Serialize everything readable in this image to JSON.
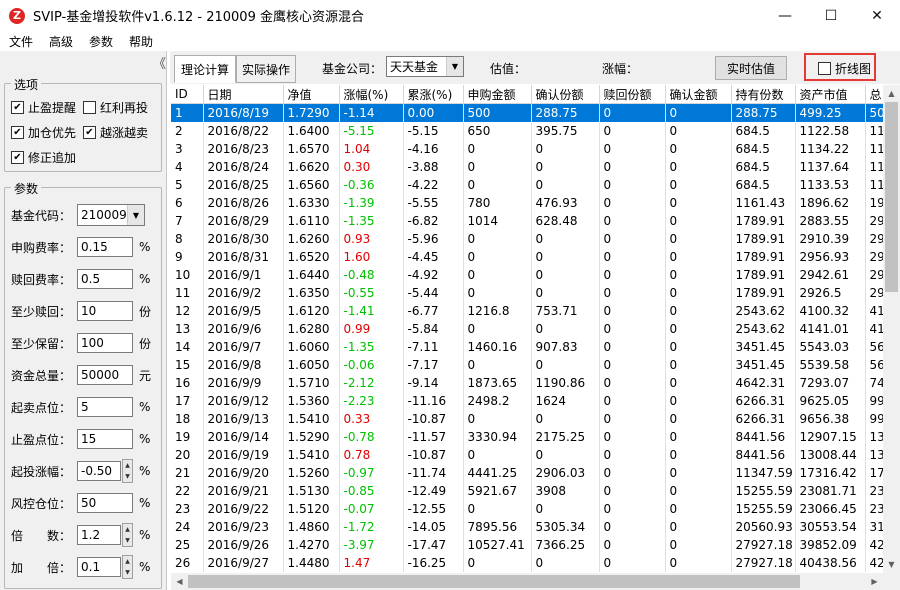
{
  "window": {
    "title": "SVIP-基金增投软件v1.6.12 - 210009 金鹰核心资源混合",
    "logo_letter": "Z",
    "minimize": "—",
    "maximize": "☐",
    "close": "✕"
  },
  "menu": [
    "文件",
    "高级",
    "参数",
    "帮助"
  ],
  "left": {
    "collapse": "《",
    "options_title": "选项",
    "options": [
      {
        "label": "止盈提醒",
        "checked": true
      },
      {
        "label": "红利再投",
        "checked": false
      },
      {
        "label": "加仓优先",
        "checked": true
      },
      {
        "label": "越涨越卖",
        "checked": true
      },
      {
        "label": "修正追加",
        "checked": true
      }
    ],
    "params_title": "参数",
    "fund_code_label": "基金代码：",
    "fund_code": "210009",
    "params": [
      {
        "label": "申购费率：",
        "value": "0.15",
        "unit": "%"
      },
      {
        "label": "赎回费率：",
        "value": "0.5",
        "unit": "%"
      },
      {
        "label": "至少赎回：",
        "value": "10",
        "unit": "份"
      },
      {
        "label": "至少保留：",
        "value": "100",
        "unit": "份"
      },
      {
        "label": "资金总量：",
        "value": "50000",
        "unit": "元"
      },
      {
        "label": "起卖点位：",
        "value": "5",
        "unit": "%"
      },
      {
        "label": "止盈点位：",
        "value": "15",
        "unit": "%"
      },
      {
        "label": "起投涨幅：",
        "value": "-0.50",
        "unit": "%"
      },
      {
        "label": "风控仓位：",
        "value": "50",
        "unit": "%"
      },
      {
        "label": "倍　　数：",
        "value": "1.2",
        "unit": "%"
      },
      {
        "label": "加　　倍：",
        "value": "0.1",
        "unit": "%"
      }
    ]
  },
  "toolbar": {
    "tab_theory": "理论计算",
    "tab_actual": "实际操作",
    "company_label": "基金公司：",
    "company_value": "天天基金",
    "estimate_label": "估值：",
    "change_label": "涨幅：",
    "realtime_button": "实时估值",
    "line_chart_label": "折线图",
    "line_chart_checked": false
  },
  "table": {
    "columns": [
      "ID",
      "日期",
      "净值",
      "涨幅(%)",
      "累涨(%)",
      "申购金额",
      "确认份额",
      "赎回份额",
      "确认金额",
      "持有份数",
      "资产市值",
      "总"
    ],
    "rows": [
      [
        "1",
        "2016/8/19",
        "1.7290",
        "-1.14",
        "0.00",
        "500",
        "288.75",
        "0",
        "0",
        "288.75",
        "499.25",
        "50"
      ],
      [
        "2",
        "2016/8/22",
        "1.6400",
        "-5.15",
        "-5.15",
        "650",
        "395.75",
        "0",
        "0",
        "684.5",
        "1122.58",
        "11"
      ],
      [
        "3",
        "2016/8/23",
        "1.6570",
        "1.04",
        "-4.16",
        "0",
        "0",
        "0",
        "0",
        "684.5",
        "1134.22",
        "11"
      ],
      [
        "4",
        "2016/8/24",
        "1.6620",
        "0.30",
        "-3.88",
        "0",
        "0",
        "0",
        "0",
        "684.5",
        "1137.64",
        "11"
      ],
      [
        "5",
        "2016/8/25",
        "1.6560",
        "-0.36",
        "-4.22",
        "0",
        "0",
        "0",
        "0",
        "684.5",
        "1133.53",
        "11"
      ],
      [
        "6",
        "2016/8/26",
        "1.6330",
        "-1.39",
        "-5.55",
        "780",
        "476.93",
        "0",
        "0",
        "1161.43",
        "1896.62",
        "19"
      ],
      [
        "7",
        "2016/8/29",
        "1.6110",
        "-1.35",
        "-6.82",
        "1014",
        "628.48",
        "0",
        "0",
        "1789.91",
        "2883.55",
        "29"
      ],
      [
        "8",
        "2016/8/30",
        "1.6260",
        "0.93",
        "-5.96",
        "0",
        "0",
        "0",
        "0",
        "1789.91",
        "2910.39",
        "29"
      ],
      [
        "9",
        "2016/8/31",
        "1.6520",
        "1.60",
        "-4.45",
        "0",
        "0",
        "0",
        "0",
        "1789.91",
        "2956.93",
        "29"
      ],
      [
        "10",
        "2016/9/1",
        "1.6440",
        "-0.48",
        "-4.92",
        "0",
        "0",
        "0",
        "0",
        "1789.91",
        "2942.61",
        "29"
      ],
      [
        "11",
        "2016/9/2",
        "1.6350",
        "-0.55",
        "-5.44",
        "0",
        "0",
        "0",
        "0",
        "1789.91",
        "2926.5",
        "29"
      ],
      [
        "12",
        "2016/9/5",
        "1.6120",
        "-1.41",
        "-6.77",
        "1216.8",
        "753.71",
        "0",
        "0",
        "2543.62",
        "4100.32",
        "41"
      ],
      [
        "13",
        "2016/9/6",
        "1.6280",
        "0.99",
        "-5.84",
        "0",
        "0",
        "0",
        "0",
        "2543.62",
        "4141.01",
        "41"
      ],
      [
        "14",
        "2016/9/7",
        "1.6060",
        "-1.35",
        "-7.11",
        "1460.16",
        "907.83",
        "0",
        "0",
        "3451.45",
        "5543.03",
        "56"
      ],
      [
        "15",
        "2016/9/8",
        "1.6050",
        "-0.06",
        "-7.17",
        "0",
        "0",
        "0",
        "0",
        "3451.45",
        "5539.58",
        "56"
      ],
      [
        "16",
        "2016/9/9",
        "1.5710",
        "-2.12",
        "-9.14",
        "1873.65",
        "1190.86",
        "0",
        "0",
        "4642.31",
        "7293.07",
        "74"
      ],
      [
        "17",
        "2016/9/12",
        "1.5360",
        "-2.23",
        "-11.16",
        "2498.2",
        "1624",
        "0",
        "0",
        "6266.31",
        "9625.05",
        "99"
      ],
      [
        "18",
        "2016/9/13",
        "1.5410",
        "0.33",
        "-10.87",
        "0",
        "0",
        "0",
        "0",
        "6266.31",
        "9656.38",
        "99"
      ],
      [
        "19",
        "2016/9/14",
        "1.5290",
        "-0.78",
        "-11.57",
        "3330.94",
        "2175.25",
        "0",
        "0",
        "8441.56",
        "12907.15",
        "13"
      ],
      [
        "20",
        "2016/9/19",
        "1.5410",
        "0.78",
        "-10.87",
        "0",
        "0",
        "0",
        "0",
        "8441.56",
        "13008.44",
        "13"
      ],
      [
        "21",
        "2016/9/20",
        "1.5260",
        "-0.97",
        "-11.74",
        "4441.25",
        "2906.03",
        "0",
        "0",
        "11347.59",
        "17316.42",
        "17"
      ],
      [
        "22",
        "2016/9/21",
        "1.5130",
        "-0.85",
        "-12.49",
        "5921.67",
        "3908",
        "0",
        "0",
        "15255.59",
        "23081.71",
        "23"
      ],
      [
        "23",
        "2016/9/22",
        "1.5120",
        "-0.07",
        "-12.55",
        "0",
        "0",
        "0",
        "0",
        "15255.59",
        "23066.45",
        "23"
      ],
      [
        "24",
        "2016/9/23",
        "1.4860",
        "-1.72",
        "-14.05",
        "7895.56",
        "5305.34",
        "0",
        "0",
        "20560.93",
        "30553.54",
        "31"
      ],
      [
        "25",
        "2016/9/26",
        "1.4270",
        "-3.97",
        "-17.47",
        "10527.41",
        "7366.25",
        "0",
        "0",
        "27927.18",
        "39852.09",
        "42"
      ],
      [
        "26",
        "2016/9/27",
        "1.4480",
        "1.47",
        "-16.25",
        "0",
        "0",
        "0",
        "0",
        "27927.18",
        "40438.56",
        "42"
      ]
    ]
  },
  "colors": {
    "up": "#e00000",
    "down": "#00c000",
    "selected_row": "#0078d7",
    "highlight_border": "#e53935"
  }
}
